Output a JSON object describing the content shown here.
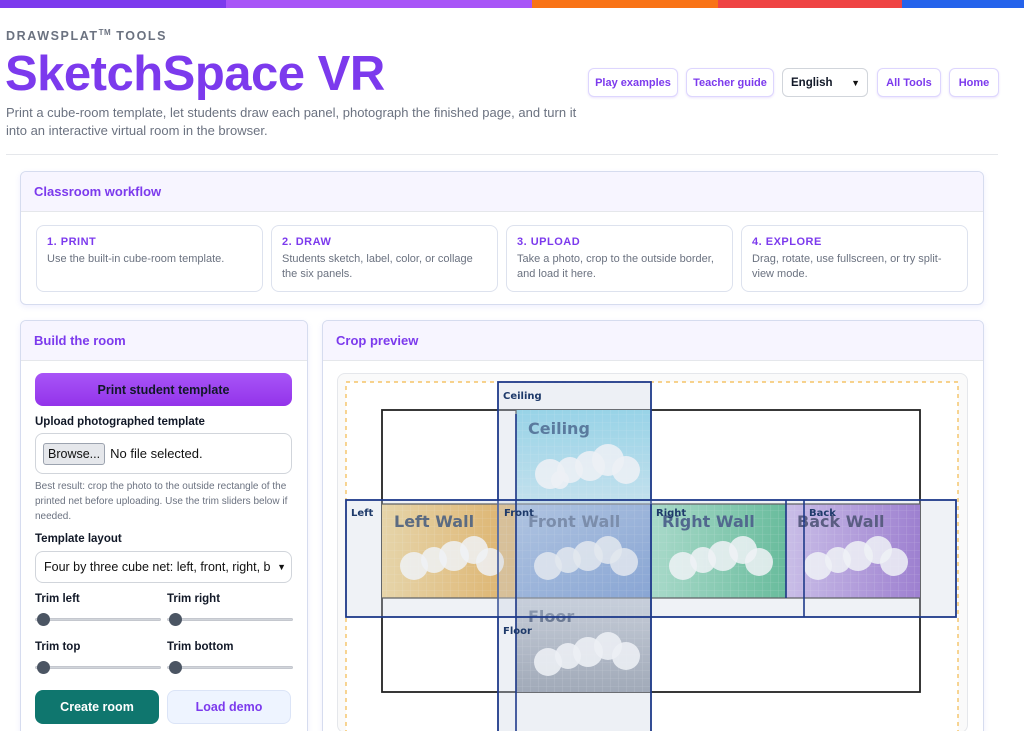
{
  "topbar_colors": [
    "#7c3aed",
    "#a855f7",
    "#f97316",
    "#ef4444",
    "#2563eb"
  ],
  "brand": {
    "prefix": "DRAWSPLAT",
    "sup": "TM",
    "suffix": " TOOLS"
  },
  "title": "SketchSpace VR",
  "subtitle": "Print a cube-room template, let students draw each panel, photograph the finished page, and turn it into an interactive virtual room in the browser.",
  "nav": {
    "play": "Play examples",
    "guide": "Teacher guide",
    "language": "English",
    "all_tools": "All Tools",
    "home": "Home"
  },
  "workflow": {
    "heading": "Classroom workflow",
    "steps": [
      {
        "title": "1. PRINT",
        "desc": "Use the built-in cube-room template."
      },
      {
        "title": "2. DRAW",
        "desc": "Students sketch, label, color, or collage the six panels."
      },
      {
        "title": "3. UPLOAD",
        "desc": "Take a photo, crop to the outside border, and load it here."
      },
      {
        "title": "4. EXPLORE",
        "desc": "Drag, rotate, use fullscreen, or try split-view mode."
      }
    ]
  },
  "build": {
    "heading": "Build the room",
    "print_button": "Print student template",
    "upload_label": "Upload photographed template",
    "browse": "Browse...",
    "file_status": "No file selected.",
    "hint": "Best result: crop the photo to the outside rectangle of the printed net before uploading. Use the trim sliders below if needed.",
    "layout_label": "Template layout",
    "layout_value": "Four by three cube net: left, front, right, b",
    "trim_left": "Trim left",
    "trim_right": "Trim right",
    "trim_top": "Trim top",
    "trim_bottom": "Trim bottom",
    "trim_values": {
      "left": 0,
      "right": 0,
      "top": 0,
      "bottom": 0
    },
    "create_button": "Create room",
    "demo_button": "Load demo"
  },
  "preview": {
    "heading": "Crop preview",
    "panels": {
      "ceiling": "Ceiling",
      "left": "Left Wall",
      "front": "Front Wall",
      "right": "Right Wall",
      "back": "Back Wall",
      "floor": "Floor"
    },
    "tags": {
      "ceiling": "Ceiling",
      "left": "Left",
      "front": "Front",
      "right": "Right",
      "back": "Back",
      "floor": "Floor"
    }
  }
}
